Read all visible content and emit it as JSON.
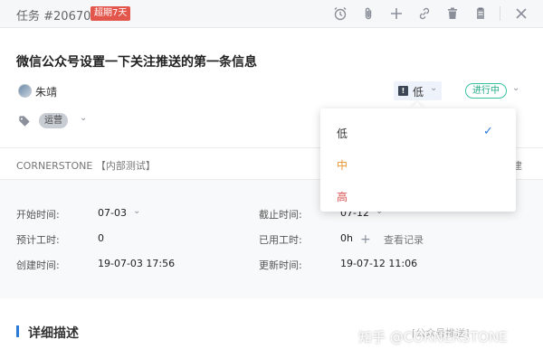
{
  "header": {
    "task_id": "任务 #20670",
    "overdue_badge": "超期7天",
    "tools": [
      "alarm-clock-icon",
      "paperclip-icon",
      "plus-icon",
      "link-icon",
      "trash-icon",
      "clipboard-icon",
      "close-icon"
    ]
  },
  "task": {
    "title": "微信公众号设置一下关注推送的第一条信息",
    "assignee": "朱靖",
    "priority": "低",
    "status": "进行中",
    "tag": "运营"
  },
  "project": {
    "name": "CORNERSTONE 【内部测试】",
    "right_text": "建"
  },
  "info": {
    "start_label": "开始时间:",
    "start_value": "07-03",
    "deadline_label": "截止时间:",
    "deadline_value": "07-12",
    "estimate_label": "预计工时:",
    "estimate_value": "0",
    "used_label": "已用工时:",
    "used_value": "0h",
    "view_records": "查看记录",
    "created_label": "创建时间:",
    "created_value": "19-07-03 17:56",
    "updated_label": "更新时间:",
    "updated_value": "19-07-12 11:06"
  },
  "detail": {
    "title": "详细描述",
    "right_text": "[公众号推送]"
  },
  "watermark": "知乎 @CORNERSTONE",
  "priority_dropdown": {
    "options": [
      {
        "label": "低",
        "color": "#333333",
        "selected": true
      },
      {
        "label": "中",
        "color": "#e8962e",
        "selected": false
      },
      {
        "label": "高",
        "color": "#d94f4f",
        "selected": false
      }
    ],
    "check": "✓"
  },
  "colors": {
    "overdue": "#e3564b",
    "status": "#1fa884",
    "accent": "#2b7bd6"
  }
}
